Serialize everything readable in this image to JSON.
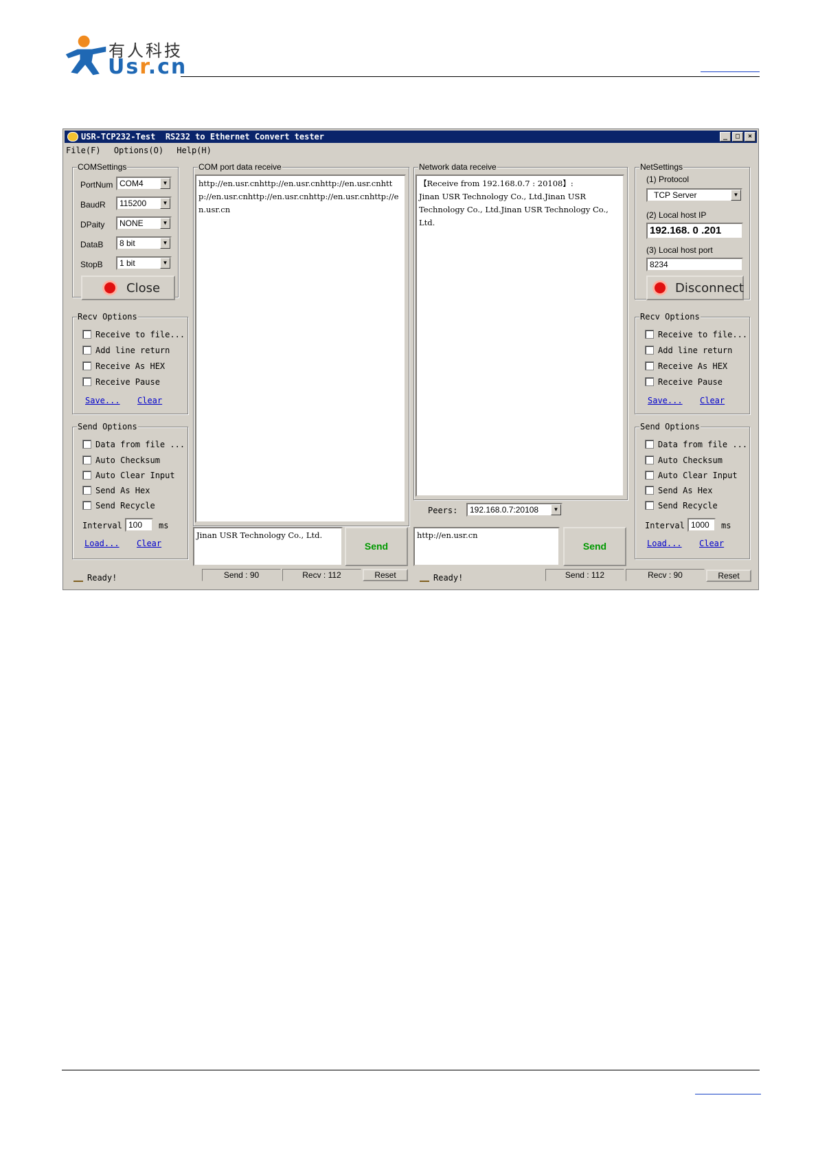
{
  "header": {
    "logo_cn": "有人科技",
    "logo_en": [
      "Us",
      "r",
      ".cn"
    ]
  },
  "window": {
    "title": "USR-TCP232-Test  RS232 to Ethernet Convert tester",
    "controls": [
      "_",
      "□",
      "×"
    ],
    "menu": [
      "File(F)",
      "Options(O)",
      "Help(H)"
    ]
  },
  "com_settings": {
    "title": "COMSettings",
    "rows": [
      {
        "label": "PortNum",
        "value": "COM4"
      },
      {
        "label": "BaudR",
        "value": "115200"
      },
      {
        "label": "DPaity",
        "value": "NONE"
      },
      {
        "label": "DataB",
        "value": "8 bit"
      },
      {
        "label": "StopB",
        "value": "1 bit"
      }
    ],
    "button": "Close"
  },
  "left_recv": {
    "title": "Recv Options",
    "options": [
      "Receive to file...",
      "Add line return",
      "Receive As HEX",
      "Receive Pause"
    ],
    "save": "Save...",
    "clear": "Clear"
  },
  "left_send": {
    "title": "Send Options",
    "options": [
      "Data from file ...",
      "Auto Checksum",
      "Auto Clear Input",
      "Send As Hex",
      "Send Recycle"
    ],
    "interval_label": "Interval",
    "interval": "100",
    "unit": "ms",
    "load": "Load...",
    "clear": "Clear"
  },
  "com_receive": {
    "title": "COM port data receive",
    "text": "http://en.usr.cnhttp://en.usr.cnhttp://en.usr.cnhttp://en.usr.cnhttp://en.usr.cnhttp://en.usr.cnhttp://en.usr.cn",
    "input": "Jinan USR Technology Co., Ltd.",
    "send": "Send"
  },
  "net_receive": {
    "title": "Network data receive",
    "text": "【Receive from 192.168.0.7 : 20108】:\nJinan USR Technology Co., Ltd.Jinan USR Technology Co., Ltd.Jinan USR Technology Co., Ltd.",
    "peers_label": "Peers:",
    "peers_value": "192.168.0.7:20108",
    "input": "http://en.usr.cn",
    "send": "Send"
  },
  "net_settings": {
    "title": "NetSettings",
    "protocol_label": "(1) Protocol",
    "protocol": "TCP Server",
    "ip_label": "(2) Local host IP",
    "ip": "192.168. 0 .201",
    "port_label": "(3) Local host port",
    "port": "8234",
    "button": "Disconnect"
  },
  "right_recv": {
    "title": "Recv Options",
    "options": [
      "Receive to file...",
      "Add line return",
      "Receive As HEX",
      "Receive Pause"
    ],
    "save": "Save...",
    "clear": "Clear"
  },
  "right_send": {
    "title": "Send Options",
    "options": [
      "Data from file ...",
      "Auto Checksum",
      "Auto Clear Input",
      "Send As Hex",
      "Send Recycle"
    ],
    "interval_label": "Interval",
    "interval": "1000",
    "unit": "ms",
    "load": "Load...",
    "clear": "Clear"
  },
  "status_left": {
    "ready": "Ready!",
    "send": "Send : 90",
    "recv": "Recv : 112",
    "reset": "Reset"
  },
  "status_right": {
    "ready": "Ready!",
    "send": "Send : 112",
    "recv": "Recv : 90",
    "reset": "Reset"
  }
}
